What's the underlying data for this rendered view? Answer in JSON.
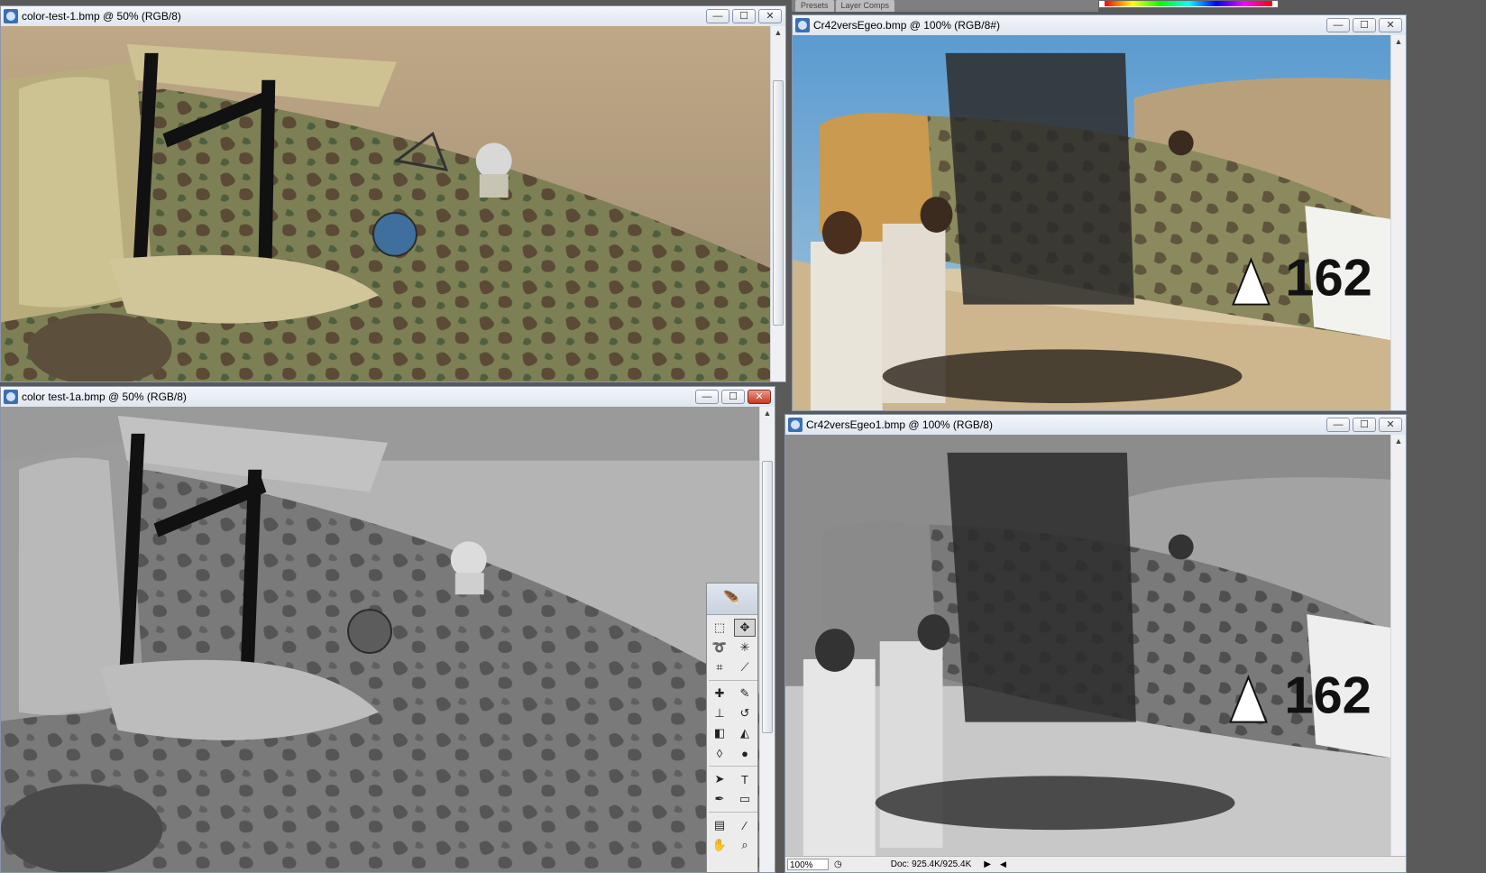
{
  "windows": [
    {
      "id": "win1",
      "title": "color-test-1.bmp @ 50% (RGB/8)",
      "controls": [
        "minimize",
        "maximize",
        "close"
      ]
    },
    {
      "id": "win2",
      "title": "color test-1a.bmp @ 50% (RGB/8)",
      "controls": [
        "minimize",
        "maximize",
        "close"
      ]
    },
    {
      "id": "win3",
      "title": "Cr42versEgeo.bmp @ 100% (RGB/8#)",
      "controls": [
        "minimize",
        "maximize",
        "close"
      ]
    },
    {
      "id": "win4",
      "title": "Cr42versEgeo1.bmp @ 100% (RGB/8)",
      "controls": [
        "minimize",
        "maximize",
        "close"
      ]
    }
  ],
  "control_glyphs": {
    "minimize": "—",
    "maximize": "☐",
    "close": "✕"
  },
  "photo": {
    "aircraft_number": "162"
  },
  "status": {
    "zoom": "100%",
    "doc": "Doc: 925.4K/925.4K"
  },
  "panel_tabs": [
    "Presets",
    "Layer Comps"
  ],
  "toolbox": {
    "tools": [
      "marquee-icon",
      "move-icon",
      "lasso-icon",
      "magic-wand-icon",
      "crop-icon",
      "slice-icon",
      "healing-icon",
      "brush-icon",
      "stamp-icon",
      "history-brush-icon",
      "eraser-icon",
      "bucket-icon",
      "blur-icon",
      "dodge-icon",
      "path-select-icon",
      "type-icon",
      "pen-icon",
      "shape-icon",
      "notes-icon",
      "eyedropper-icon",
      "hand-icon",
      "zoom-icon"
    ]
  },
  "colors": {
    "camo_dark": "#5b4a36",
    "camo_green": "#6f7a4d",
    "sand": "#c9b48f",
    "sky": "#5b9bd0"
  }
}
